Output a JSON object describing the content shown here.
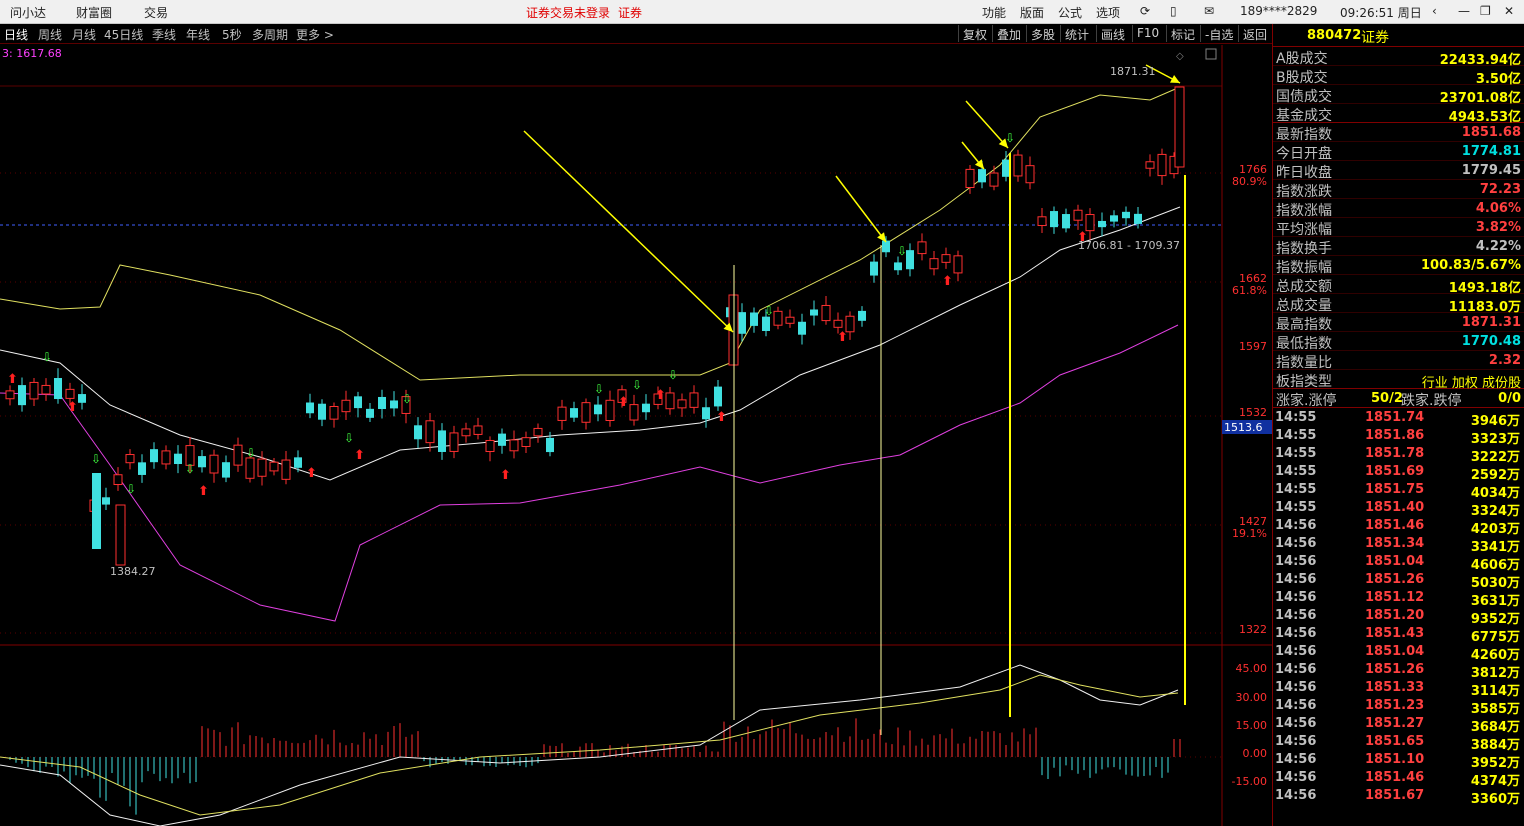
{
  "topbar": {
    "menu": [
      "问小达",
      "财富圈",
      "交易"
    ],
    "notice": "证券交易未登录",
    "notice_tag": "证券",
    "right_menu": [
      "功能",
      "版面",
      "公式",
      "选项"
    ],
    "user": "189****2829",
    "clock": "09:26:51 周日"
  },
  "periods": [
    "日线",
    "周线",
    "月线",
    "45日线",
    "季线",
    "年线",
    "5秒",
    "多周期",
    "更多 >"
  ],
  "tools": [
    "复权",
    "叠加",
    "多股",
    "统计",
    "画线",
    "F10",
    "标记",
    "-自选",
    "返回"
  ],
  "chart": {
    "ma_label": "3: 1617.68",
    "high_label": "1871.31",
    "low_label": "1384.27",
    "range_label": "1706.81 - 1709.37",
    "cursor_price": "1513.6",
    "price_axis": [
      {
        "v": "1766",
        "p": "80.9%"
      },
      {
        "v": "1662",
        "p": "61.8%"
      },
      {
        "v": "1597",
        "p": ""
      },
      {
        "v": "1532",
        "p": ""
      },
      {
        "v": "1427",
        "p": "19.1%"
      },
      {
        "v": "1322",
        "p": ""
      }
    ],
    "macd_axis": [
      "45.00",
      "30.00",
      "15.00",
      "0.00",
      "-15.00"
    ]
  },
  "panel": {
    "code": "880472",
    "name": "证券",
    "stats": [
      {
        "label": "A股成交",
        "value": "22433.94亿",
        "color": "yellow"
      },
      {
        "label": "B股成交",
        "value": "3.50亿",
        "color": "yellow"
      },
      {
        "label": "国债成交",
        "value": "23701.08亿",
        "color": "yellow"
      },
      {
        "label": "基金成交",
        "value": "4943.53亿",
        "color": "yellow"
      },
      {
        "label": "最新指数",
        "value": "1851.68",
        "color": "red"
      },
      {
        "label": "今日开盘",
        "value": "1774.81",
        "color": "cyan"
      },
      {
        "label": "昨日收盘",
        "value": "1779.45",
        "color": "gray"
      },
      {
        "label": "指数涨跌",
        "value": "72.23",
        "color": "red"
      },
      {
        "label": "指数涨幅",
        "value": "4.06%",
        "color": "red"
      },
      {
        "label": "平均涨幅",
        "value": "3.82%",
        "color": "red"
      },
      {
        "label": "指数换手",
        "value": "4.22%",
        "color": "gray"
      },
      {
        "label": "指数振幅",
        "value": "100.83/5.67%",
        "color": "yellow"
      },
      {
        "label": "总成交额",
        "value": "1493.18亿",
        "color": "yellow"
      },
      {
        "label": "总成交量",
        "value": "11183.0万",
        "color": "yellow"
      },
      {
        "label": "最高指数",
        "value": "1871.31",
        "color": "red"
      },
      {
        "label": "最低指数",
        "value": "1770.48",
        "color": "cyan"
      },
      {
        "label": "指数量比",
        "value": "2.32",
        "color": "red"
      }
    ],
    "type_label": "板指类型",
    "type_value": "行业 加权 成份股",
    "updown_label": "涨家.涨停",
    "updown_value": "50/2",
    "down_label": "跌家.跌停",
    "down_value": "0/0",
    "ticks": [
      [
        "14:55",
        "1851.74",
        "3946万"
      ],
      [
        "14:55",
        "1851.86",
        "3323万"
      ],
      [
        "14:55",
        "1851.78",
        "3222万"
      ],
      [
        "14:55",
        "1851.69",
        "2592万"
      ],
      [
        "14:55",
        "1851.75",
        "4034万"
      ],
      [
        "14:55",
        "1851.40",
        "3324万"
      ],
      [
        "14:56",
        "1851.46",
        "4203万"
      ],
      [
        "14:56",
        "1851.34",
        "3341万"
      ],
      [
        "14:56",
        "1851.04",
        "4606万"
      ],
      [
        "14:56",
        "1851.26",
        "5030万"
      ],
      [
        "14:56",
        "1851.12",
        "3631万"
      ],
      [
        "14:56",
        "1851.20",
        "9352万"
      ],
      [
        "14:56",
        "1851.43",
        "6775万"
      ],
      [
        "14:56",
        "1851.04",
        "4260万"
      ],
      [
        "14:56",
        "1851.26",
        "3812万"
      ],
      [
        "14:56",
        "1851.33",
        "3114万"
      ],
      [
        "14:56",
        "1851.23",
        "3585万"
      ],
      [
        "14:56",
        "1851.27",
        "3684万"
      ],
      [
        "14:56",
        "1851.65",
        "3884万"
      ],
      [
        "14:56",
        "1851.10",
        "3952万"
      ],
      [
        "14:56",
        "1851.46",
        "4374万"
      ],
      [
        "14:56",
        "1851.67",
        "3360万"
      ]
    ]
  }
}
